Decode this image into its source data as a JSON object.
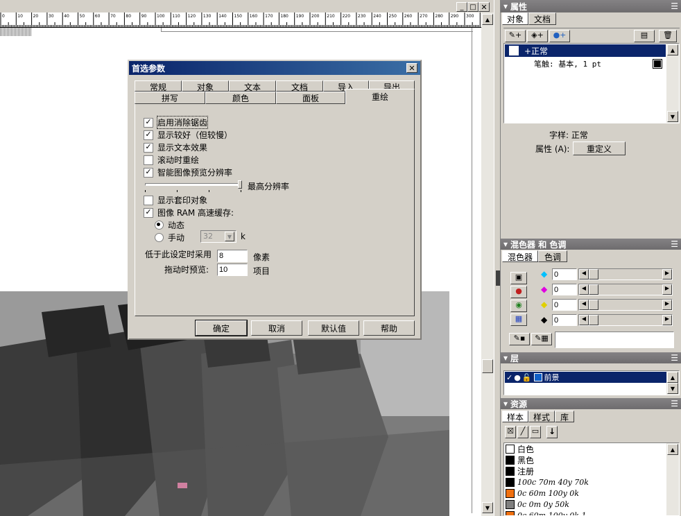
{
  "dialog": {
    "title": "首选参数",
    "tabs_row1": [
      "常规",
      "对象",
      "文本",
      "文档",
      "导入",
      "导出"
    ],
    "tabs_row2": [
      "拼写",
      "颜色",
      "面板",
      "重绘"
    ],
    "active_tab": "重绘",
    "options": [
      {
        "label": "启用消除锯齿",
        "checked": true
      },
      {
        "label": "显示较好（但较慢）",
        "checked": true
      },
      {
        "label": "显示文本效果",
        "checked": true
      },
      {
        "label": "滚动时重绘",
        "checked": false
      },
      {
        "label": "智能图像预览分辨率",
        "checked": true
      }
    ],
    "slider_label": "最高分辨率",
    "opt_print": {
      "label": "显示套印对象",
      "checked": false
    },
    "opt_ram": {
      "label": "图像 RAM 高速缓存:",
      "checked": true
    },
    "radio_dynamic": "动态",
    "radio_manual": "手动",
    "manual_value": "32",
    "manual_unit": "k",
    "low_label": "低于此设定时采用",
    "low_value": "8",
    "low_unit": "像素",
    "drag_label": "拖动时预览:",
    "drag_value": "10",
    "drag_unit": "项目",
    "buttons": {
      "ok": "确定",
      "cancel": "取消",
      "default": "默认值",
      "help": "帮助"
    }
  },
  "ruler": {
    "ticks": [
      "0",
      "10",
      "20",
      "30",
      "40",
      "50",
      "60",
      "70",
      "80",
      "90",
      "100",
      "110",
      "120",
      "130",
      "140",
      "150",
      "160",
      "170",
      "180",
      "190",
      "200",
      "210",
      "220",
      "230",
      "240",
      "250",
      "260",
      "270",
      "280",
      "290",
      "300"
    ]
  },
  "props": {
    "title": "属性",
    "tabs": [
      "对象",
      "文档"
    ],
    "item1": "+正常",
    "item2": "笔触: 基本, 1 pt",
    "style_label": "字样: 正常",
    "attr_label": "属性 (A):",
    "redefine": "重定义"
  },
  "mixer": {
    "title": "混色器 和 色调",
    "tabs": [
      "混色器",
      "色调"
    ],
    "values": [
      "0",
      "0",
      "0",
      "0"
    ],
    "colors": [
      "#00c0ff",
      "#e000e0",
      "#e0e000",
      "#000000"
    ]
  },
  "layers": {
    "title": "层",
    "item": "前景",
    "item_color": "#1060c8"
  },
  "assets": {
    "title": "资源",
    "tabs": [
      "样本",
      "样式",
      "库"
    ],
    "swatches": [
      {
        "name": "白色",
        "color": "#ffffff",
        "italic": false
      },
      {
        "name": "黑色",
        "color": "#000000",
        "italic": false
      },
      {
        "name": "注册",
        "color": "#000000",
        "italic": false
      },
      {
        "name": "100c 70m 40y 70k",
        "color": "#000000",
        "italic": true
      },
      {
        "name": "0c 60m 100y 0k",
        "color": "#f07010",
        "italic": true
      },
      {
        "name": "0c 0m 0y 50k",
        "color": "#808080",
        "italic": true
      },
      {
        "name": "0c 60m 100y 0k-1",
        "color": "#f07010",
        "italic": true
      }
    ]
  }
}
